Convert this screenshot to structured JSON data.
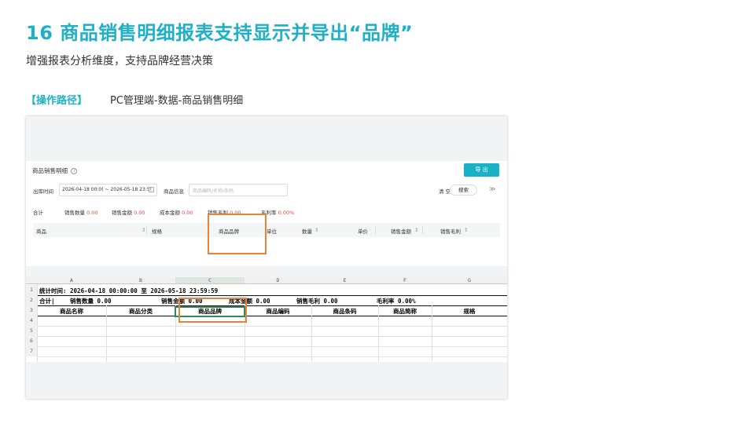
{
  "slide": {
    "title": "16 商品销售明细报表支持显示并导出“品牌”",
    "subtitle": "增强报表分析维度，支持品牌经营决策",
    "path_label": "【操作路径】",
    "path_value": "PC管理端-数据-商品销售明细"
  },
  "colors": {
    "accent": "#1fb0c8",
    "highlight": "#e8843a",
    "value_red": "#e5483f"
  },
  "report": {
    "title": "商品销售明细",
    "help_icon": "question-circle-icon",
    "export_label": "导 出",
    "filters": {
      "outbound_time_label": "出库时间",
      "date_range": "2026-04-18 00:0( ~ 2026-05-18 23:5!",
      "product_info_label": "商品信息",
      "product_placeholder": "商品编码/名称/条码",
      "clear_label": "清 空",
      "search_label": "搜索",
      "expand_icon": "chevron-double-down-icon"
    },
    "summary": {
      "total_label": "合计",
      "items": [
        {
          "label": "销售数量",
          "value": "0.00"
        },
        {
          "label": "销售金额",
          "value": "0.00"
        },
        {
          "label": "成本金额",
          "value": "0.00"
        },
        {
          "label": "销售毛利",
          "value": "0.00"
        },
        {
          "label": "毛利率",
          "value": "0.00%"
        }
      ]
    },
    "columns": [
      "商品",
      "规格",
      "商品品牌",
      "单位",
      "数量",
      "单价",
      "销售金额",
      "销售毛利"
    ],
    "sort_icon": "sort-icon"
  },
  "sheet": {
    "col_letters": [
      "A",
      "B",
      "C",
      "D",
      "E",
      "F",
      "G"
    ],
    "row_numbers": [
      "1",
      "2",
      "3",
      "4",
      "5",
      "6",
      "7"
    ],
    "stat_time": "统计时间: 2026-04-18 00:00:00 至 2026-05-18 23:59:59",
    "total_row": {
      "label": "合计|",
      "items": [
        {
          "label": "销售数量",
          "value": "0.00"
        },
        {
          "label": "销售金额",
          "value": "0.00"
        },
        {
          "label": "成本金额",
          "value": "0.00"
        },
        {
          "label": "销售毛利",
          "value": "0.00"
        },
        {
          "label": "毛利率",
          "value": "0.00%"
        }
      ]
    },
    "headers": [
      "商品名称",
      "商品分类",
      "商品品牌",
      "商品编码",
      "商品条码",
      "商品简称",
      "规格"
    ]
  }
}
